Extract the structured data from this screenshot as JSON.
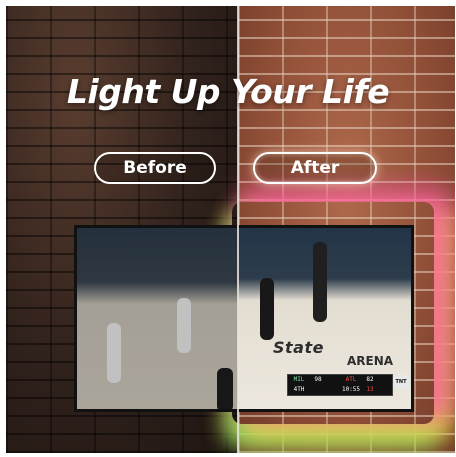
{
  "headline": "Light Up Your Life",
  "labels": {
    "before": "Before",
    "after": "After"
  },
  "scoreboard": {
    "team1": "MIL",
    "score1": "98",
    "team2": "ATL",
    "score2": "82",
    "quarter": "4TH",
    "clock": "10:55",
    "shot_clock": "13",
    "network": "TNT"
  },
  "court_text": {
    "line1": "State",
    "line2": "ARENA"
  },
  "colors": {
    "glow_pink": "#ff50aa",
    "glow_yellow": "#ffe63c",
    "glow_green": "#50ff78"
  }
}
